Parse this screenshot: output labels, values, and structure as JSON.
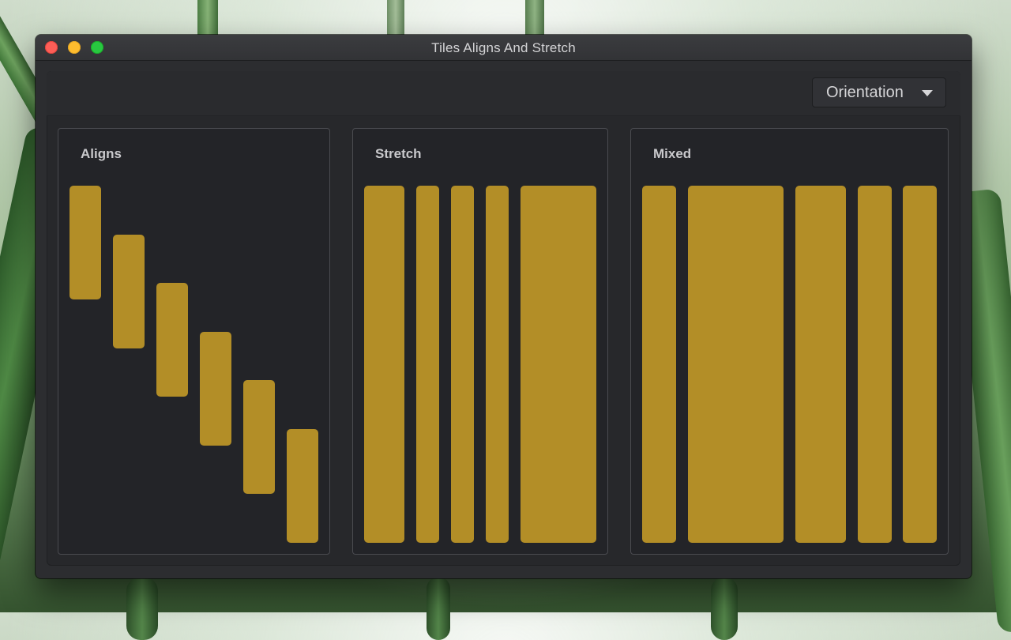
{
  "window": {
    "title": "Tiles Aligns And Stretch"
  },
  "toolbar": {
    "orientation_label": "Orientation"
  },
  "panels": {
    "aligns": {
      "title": "Aligns"
    },
    "stretch": {
      "title": "Stretch"
    },
    "mixed": {
      "title": "Mixed"
    }
  },
  "colors": {
    "tile": "#b38e27",
    "panel_bg": "#232428",
    "panel_border": "#4a4b50",
    "window_bg": "#2c2d30"
  },
  "icons": [
    "close-traffic-light",
    "minimize-traffic-light",
    "maximize-traffic-light",
    "dropdown-caret-icon"
  ]
}
